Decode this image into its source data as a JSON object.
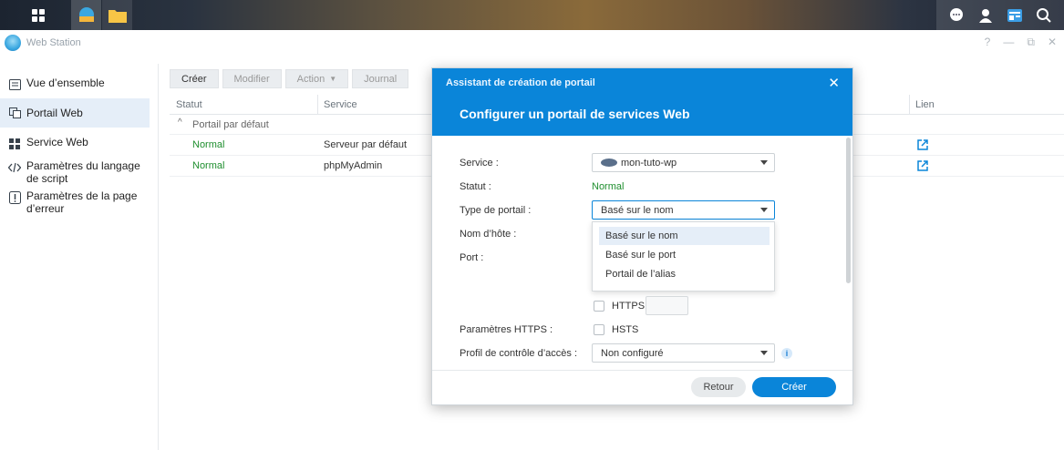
{
  "app": {
    "title": "Web Station"
  },
  "window_controls": [
    "?",
    "—",
    "⧉",
    "✕"
  ],
  "sidebar": {
    "items": [
      {
        "label": "Vue d’ensemble",
        "icon": "overview-icon"
      },
      {
        "label": "Portail Web",
        "icon": "portal-icon"
      },
      {
        "label": "Service Web",
        "icon": "grid-icon"
      },
      {
        "label": "Paramètres du langage de script",
        "icon": "code-icon"
      },
      {
        "label": "Paramètres de la page d’erreur",
        "icon": "error-icon"
      }
    ]
  },
  "toolbar": {
    "create": "Créer",
    "modify": "Modifier",
    "action": "Action",
    "journal": "Journal"
  },
  "table": {
    "headers": {
      "status": "Statut",
      "service": "Service",
      "link": "Lien"
    },
    "group": "Portail par défaut",
    "rows": [
      {
        "status": "Normal",
        "service": "Serveur par défaut"
      },
      {
        "status": "Normal",
        "service": "phpMyAdmin"
      }
    ]
  },
  "dialog": {
    "title": "Assistant de création de portail",
    "subtitle": "Configurer un portail de services Web",
    "fields": {
      "service_label": "Service :",
      "service_value": "mon-tuto-wp",
      "status_label": "Statut :",
      "status_value": "Normal",
      "portal_type_label": "Type de portail :",
      "portal_type_value": "Basé sur le nom",
      "hostname_label": "Nom d’hôte :",
      "port_label": "Port :",
      "https_label": "HTTPS",
      "https_params_label": "Paramètres HTTPS :",
      "hsts_label": "HSTS",
      "access_profile_label": "Profil de contrôle d’accès :",
      "access_profile_value": "Non configuré"
    },
    "dropdown_options": [
      "Basé sur le nom",
      "Basé sur le port",
      "Portail de l’alias"
    ],
    "buttons": {
      "back": "Retour",
      "create": "Créer"
    }
  },
  "colors": {
    "accent": "#0a85d9",
    "status_ok": "#1e8e2e"
  }
}
